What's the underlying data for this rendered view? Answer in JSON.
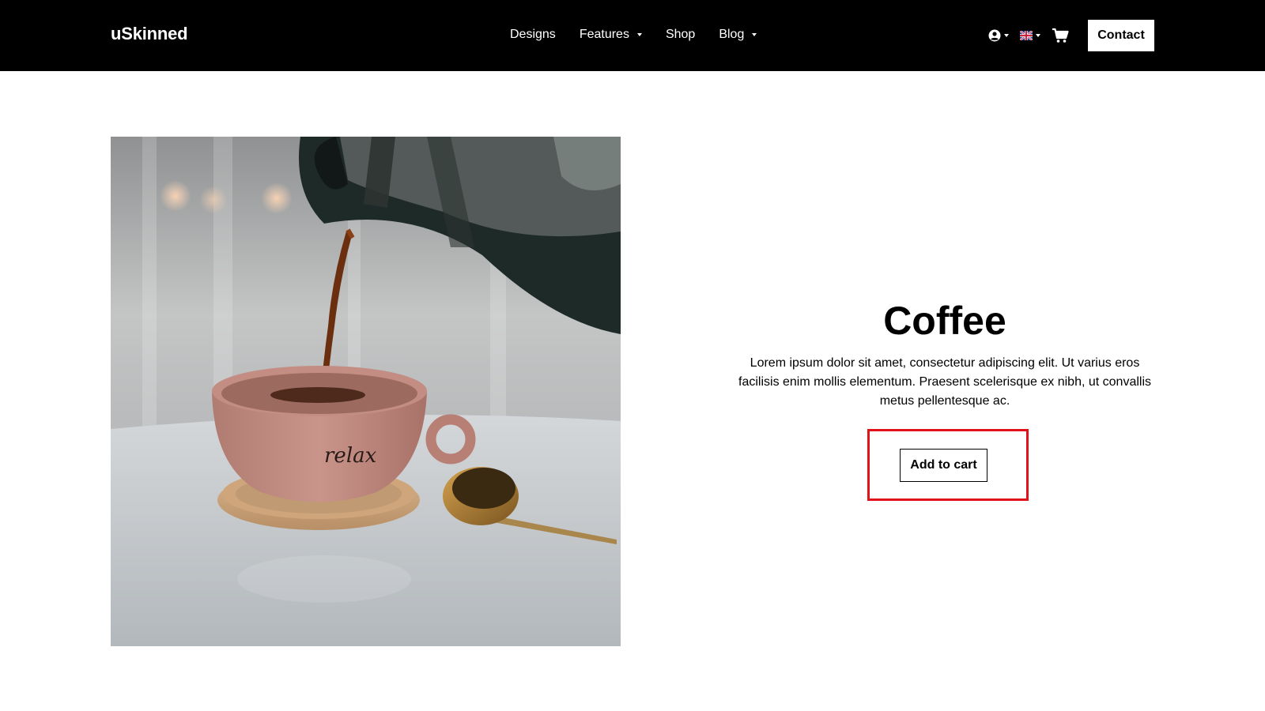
{
  "header": {
    "brand": "uSkinned",
    "nav": [
      {
        "label": "Designs",
        "has_dropdown": false
      },
      {
        "label": "Features",
        "has_dropdown": true
      },
      {
        "label": "Shop",
        "has_dropdown": false
      },
      {
        "label": "Blog",
        "has_dropdown": true
      }
    ],
    "utility": {
      "account_icon": "user-circle-icon",
      "language_icon": "uk-flag-icon",
      "cart_icon": "shopping-cart-icon"
    },
    "contact_label": "Contact"
  },
  "product": {
    "image_subject": "coffee",
    "cup_script": "relax",
    "title": "Coffee",
    "description": "Lorem ipsum dolor sit amet, consectetur adipiscing elit. Ut varius eros facilisis enim mollis elementum. Praesent scelerisque ex nibh, ut convallis metus pellentesque ac.",
    "add_to_cart_label": "Add to cart"
  },
  "colors": {
    "header_bg": "#000000",
    "highlight": "#e2121b"
  }
}
